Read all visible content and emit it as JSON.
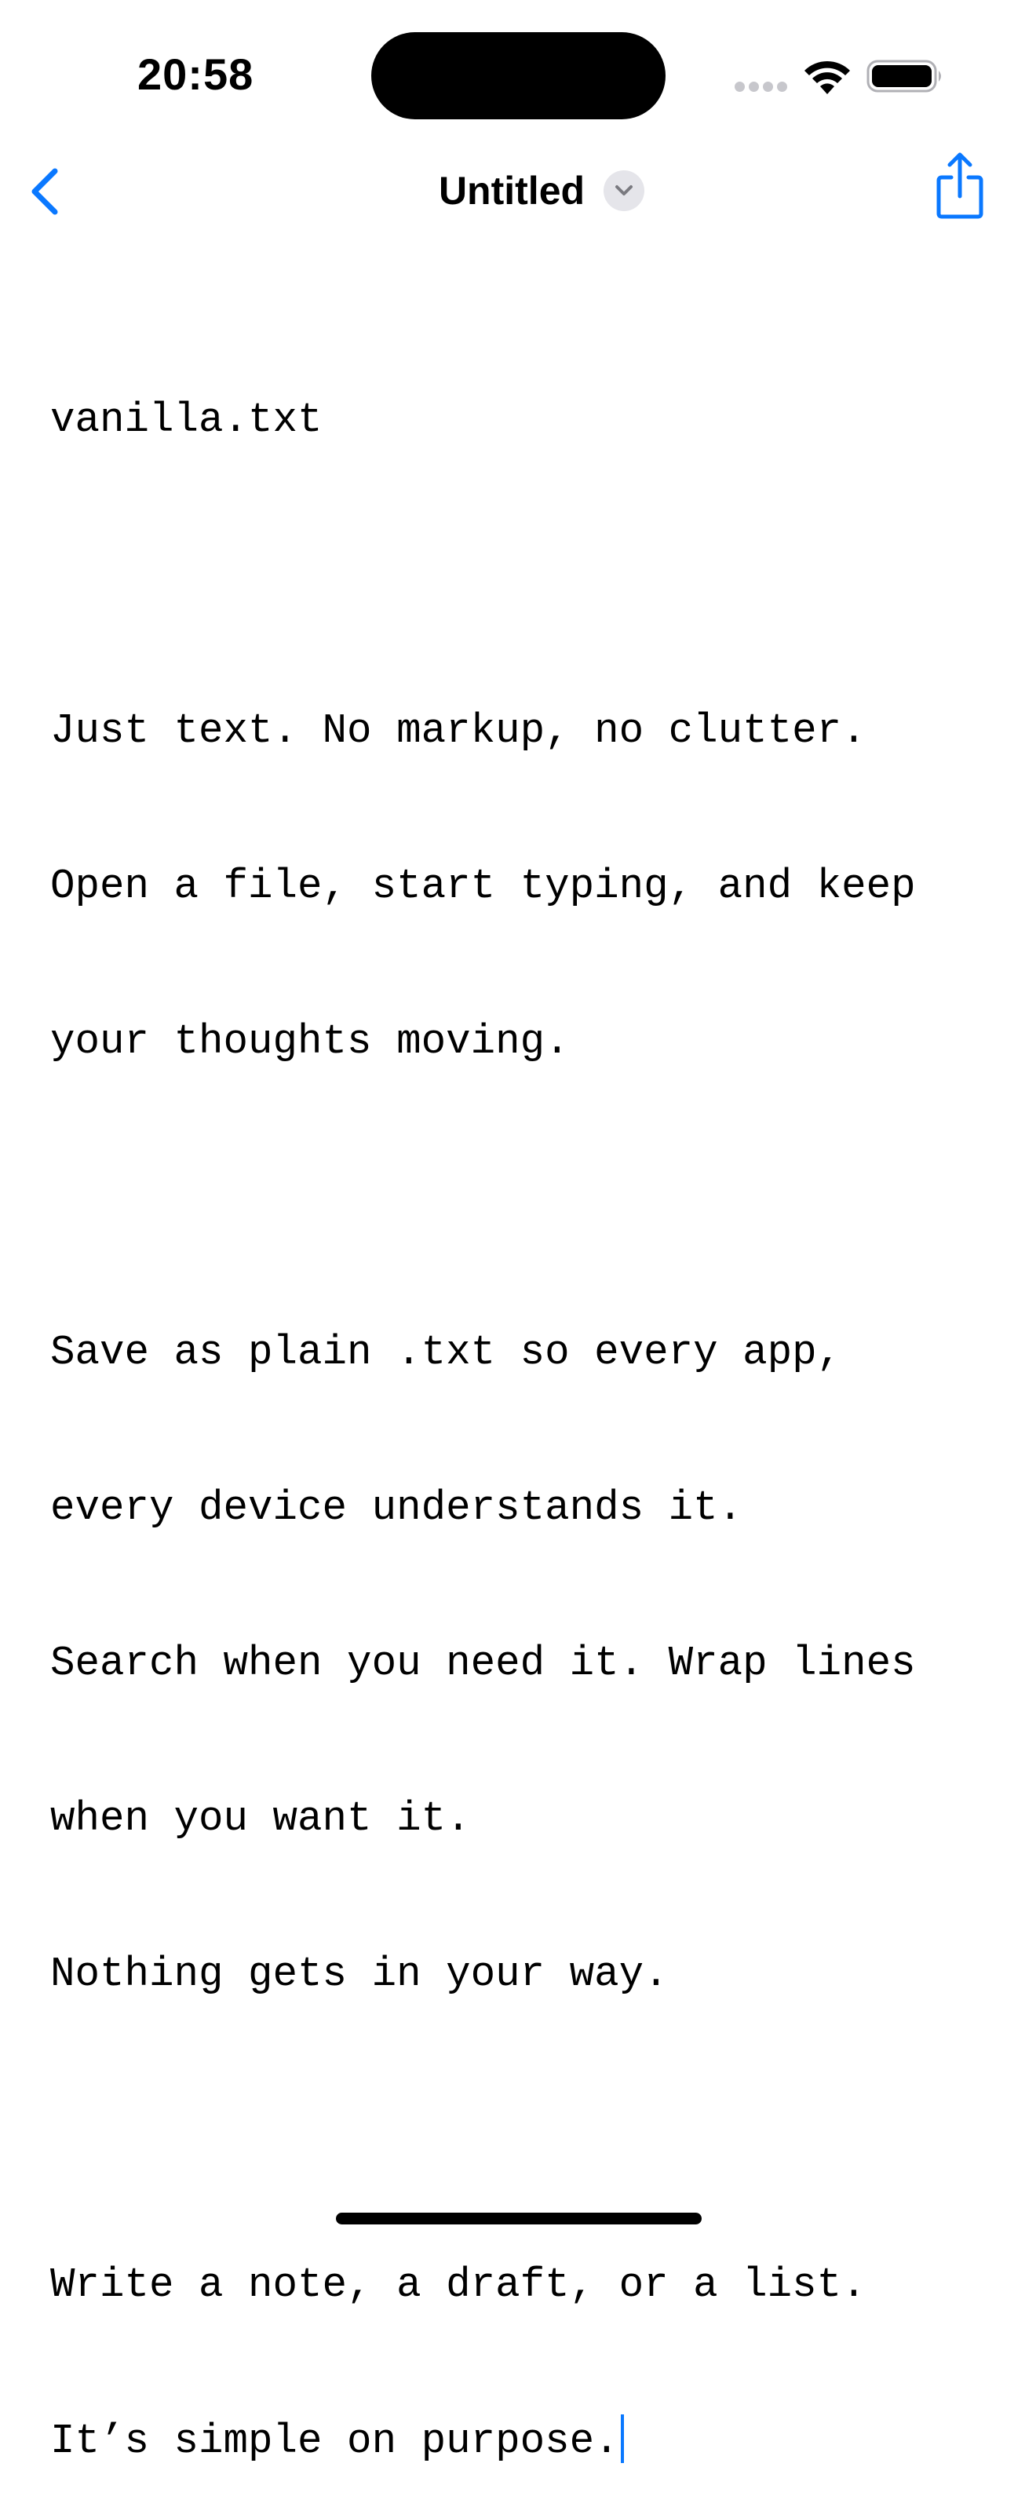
{
  "status_bar": {
    "time": "20:58",
    "icons": [
      "cellular-signal-icon",
      "wifi-icon",
      "battery-icon"
    ]
  },
  "nav": {
    "back_icon": "chevron-left-icon",
    "title": "Untitled",
    "title_menu_icon": "chevron-down-icon",
    "share_icon": "share-icon"
  },
  "document": {
    "lines": [
      "vanilla.txt",
      "",
      "Just text. No markup, no clutter.",
      "Open a file, start typing, and keep",
      "your thoughts moving.",
      "",
      "Save as plain .txt so every app,",
      "every device understands it.",
      "Search when you need it. Wrap lines",
      "when you want it.",
      "Nothing gets in your way.",
      "",
      "Write a note, a draft, or a list.",
      "It’s simple on purpose."
    ]
  },
  "colors": {
    "accent": "#0a78ff",
    "text": "#000000",
    "background": "#ffffff",
    "chip": "#e5e5ea"
  }
}
